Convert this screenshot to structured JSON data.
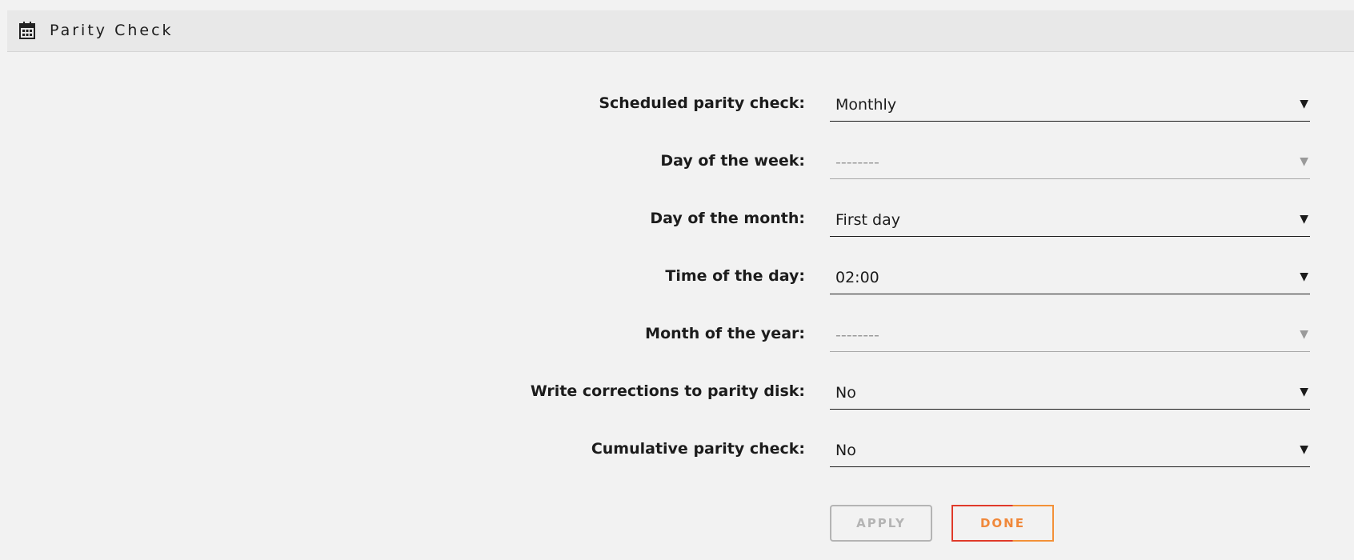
{
  "header": {
    "icon": "calendar-icon",
    "title": "Parity Check"
  },
  "form": {
    "fields": [
      {
        "label": "Scheduled parity check:",
        "value": "Monthly",
        "disabled": false
      },
      {
        "label": "Day of the week:",
        "value": "--------",
        "disabled": true
      },
      {
        "label": "Day of the month:",
        "value": "First day",
        "disabled": false
      },
      {
        "label": "Time of the day:",
        "value": "02:00",
        "disabled": false
      },
      {
        "label": "Month of the year:",
        "value": "--------",
        "disabled": true
      },
      {
        "label": "Write corrections to parity disk:",
        "value": "No",
        "disabled": false
      },
      {
        "label": "Cumulative parity check:",
        "value": "No",
        "disabled": false
      }
    ],
    "caret": "▼"
  },
  "buttons": {
    "apply_label": "APPLY",
    "done_label": "DONE"
  },
  "colors": {
    "background": "#f2f2f2",
    "header_bg": "#e8e8e8",
    "done_red": "#e03a2a",
    "done_orange": "#f39138",
    "disabled_gray": "#b4b4b4"
  }
}
